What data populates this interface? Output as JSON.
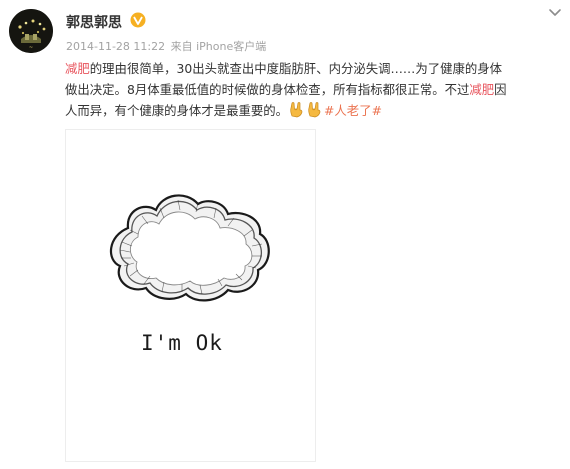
{
  "post": {
    "username": "郭思郭思",
    "timestamp": "2014-11-28 11:22",
    "source": "来自 iPhone客户端",
    "content": {
      "line1_highlight": "减肥",
      "line1_rest": "的理由很简单，30出头就查出中度脂肪肝、内分泌失调……为了健康的身体",
      "line2": "做出决定。8月体重最低值的时候做的身体检查，所有指标都很正常。不过",
      "line2_highlight": "减肥",
      "line2_tail": "因",
      "line3": "人而异，有个健康的身体才是最重要的。",
      "hashtag": "#人老了#"
    },
    "image": {
      "caption": "I'm  Ok"
    },
    "icons": {
      "avatar": "avatar-image",
      "verified": "verified-badge-icon",
      "menu": "chevron-down-icon",
      "emoji": "rock-hand-emoji-icon"
    },
    "colors": {
      "highlight": "#e8555e",
      "hashtag": "#eb7350",
      "meta": "#a3a3a3",
      "verified": "#f6b022"
    }
  }
}
